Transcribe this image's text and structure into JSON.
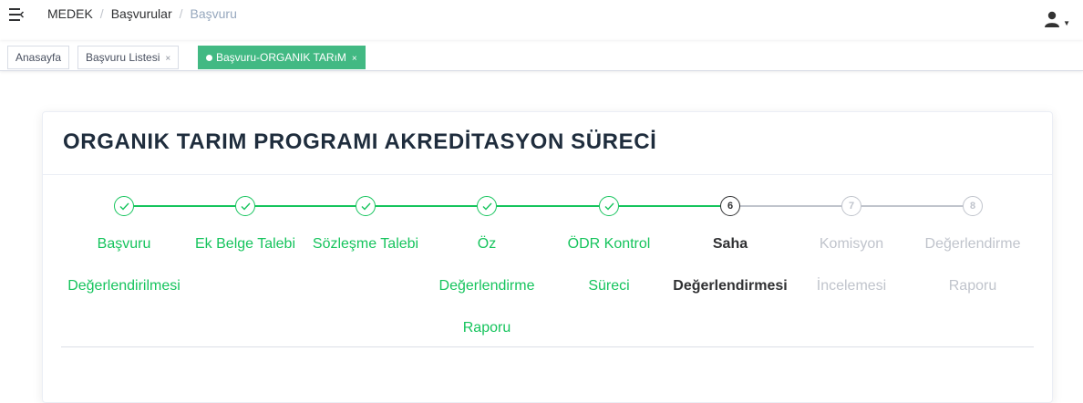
{
  "header": {
    "breadcrumb": [
      "MEDEK",
      "Başvurular",
      "Başvuru"
    ]
  },
  "tags": [
    {
      "label": "Anasayfa",
      "closable": false,
      "active": false
    },
    {
      "label": "Başvuru Listesi",
      "closable": true,
      "active": false
    },
    {
      "label": "Başvuru-ORGANIK TARıM",
      "closable": true,
      "active": true
    }
  ],
  "tag_close_glyph": "×",
  "card": {
    "title": "ORGANIK TARIM PROGRAMI AKREDİTASYON SÜRECİ"
  },
  "steps": [
    {
      "lines": [
        "Başvuru",
        "Değerlendirilmesi"
      ],
      "status": "done",
      "number": "1"
    },
    {
      "lines": [
        "Ek Belge Talebi"
      ],
      "status": "done",
      "number": "2"
    },
    {
      "lines": [
        "Sözleşme Talebi"
      ],
      "status": "done",
      "number": "3"
    },
    {
      "lines": [
        "Öz",
        "Değerlendirme",
        "Raporu"
      ],
      "status": "done",
      "number": "4"
    },
    {
      "lines": [
        "ÖDR Kontrol",
        "Süreci"
      ],
      "status": "done",
      "number": "5"
    },
    {
      "lines": [
        "Saha",
        "Değerlendirmesi"
      ],
      "status": "active",
      "number": "6"
    },
    {
      "lines": [
        "Komisyon",
        "İncelemesi"
      ],
      "status": "wait",
      "number": "7"
    },
    {
      "lines": [
        "Değerlendirme",
        "Raporu"
      ],
      "status": "wait",
      "number": "8"
    }
  ],
  "colors": {
    "accent": "#42b983",
    "done": "#16c45d",
    "active": "#303133",
    "wait": "#c0c4cc"
  },
  "icons": {
    "sidebar_toggle": "hamburger-icon",
    "user": "user-icon",
    "dropdown": "caret-down-icon",
    "step_done": "check-icon"
  }
}
